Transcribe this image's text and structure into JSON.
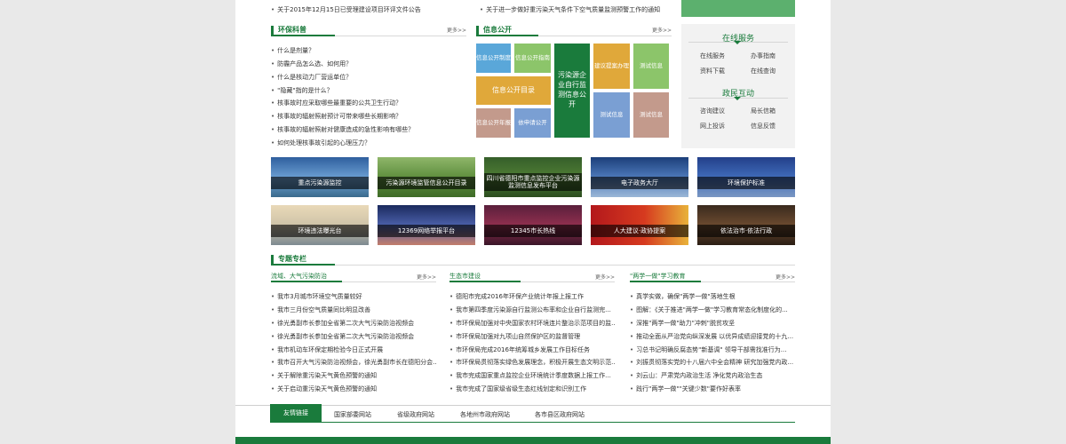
{
  "top_links": [
    "关于2015年12月15日已受理建设项目环评文件公告",
    "关于进一步做好重污染天气条件下空气质量监测预警工作的通知"
  ],
  "env_science": {
    "title": "环保科普",
    "more": "更多>>",
    "items": [
      "什么是剂量？",
      "防霾产品怎么选、如何用？",
      "什么是核动力厂营运单位？",
      "\"隐藏\"指的是什么？",
      "核事故时应采取哪些最重要的公共卫生行动？",
      "核事故的辐射照射预计可带来哪些长期影响？",
      "核事故的辐射照射对健康造成的急性影响有哪些？",
      "如何处理核事故引起的心理压力？"
    ]
  },
  "info_public": {
    "title": "信息公开",
    "more": "更多>>",
    "tiles": {
      "system": "信息公开制度",
      "guide": "信息公开指南",
      "catalog": "信息公开目录",
      "annual": "信息公开年报",
      "apply": "依申请公开",
      "enterprise": "污染源企业自行监测信息公开",
      "proposal": "建议提案办理",
      "test1": "测试信息",
      "test2": "测试信息",
      "test3": "测试信息"
    }
  },
  "online_service": {
    "title": "在线服务",
    "links": [
      "在线服务",
      "办事指南",
      "资料下载",
      "在线查询"
    ]
  },
  "interaction": {
    "title": "政民互动",
    "links": [
      "咨询建议",
      "局长信箱",
      "网上投诉",
      "信息反馈"
    ]
  },
  "image_links": [
    "重点污染源监控",
    "污染源环境监管信息公开目录",
    "四川省德阳市重点监控企业污染源监测信息发布平台",
    "电子政务大厅",
    "环境保护标准",
    "环境违法曝光台",
    "12369网络举报平台",
    "12345市长热线",
    "人大建议·政协提案",
    "依法治市·依法行政"
  ],
  "special": {
    "title": "专题专栏",
    "columns": [
      {
        "title": "流域、大气污染防治",
        "more": "更多>>",
        "items": [
          "我市3月城市环境空气质量较好",
          "我市三月份空气质量同比明显改善",
          "徐光勇副市长参加全省第二次大气污染防治视频会",
          "徐光勇副市长参加全省第二次大气污染防治视频会",
          "我市机动车环保定期检验今日正式开展",
          "我市召开大气污染防治视频会，徐光勇副市长在德阳分会...",
          "关于解除重污染天气黄色预警的通知",
          "关于启动重污染天气黄色预警的通知"
        ]
      },
      {
        "title": "生态市建设",
        "more": "更多>>",
        "items": [
          "德阳市完成2016年环保产业统计年报上报工作",
          "我市第四季度污染源自行监测公布率和企业自行监测完...",
          "市环保局加强对中央国家农村环境连片整治示范项目的监...",
          "市环保局加强对九项山自然保护区的监督管理",
          "市环保局完成2016年统筹城乡发展工作目标任务",
          "市环保局贯彻落实绿色发展理念，积极开展生态文明示范...",
          "我市完成国家重点监控企业环境统计季度数据上报工作...",
          "我市完成了国家级省级生态红线划定和识别工作"
        ]
      },
      {
        "title": "\"两学一做\"学习教育",
        "more": "更多>>",
        "items": [
          "真学实做，确保\"两学一做\"落地生根",
          "图解：《关于推进\"两学一做\"学习教育常态化制度化的...",
          "深推\"两学一做\"助力\"冲刺\"脱贫攻坚",
          "推动全面从严治党向纵深发展 以优异成绩迎接党的十九...",
          "习总书记明确反腐态势\"新基调\" 领导干部需找准行为...",
          "刘振贯彻落实党的十八届六中全会精神 研究加强党内政...",
          "刘云山：严肃党内政治生活 净化党内政治生态",
          "践行\"两学一做\"\"关键少数\"要作好表率"
        ]
      }
    ]
  },
  "footer": {
    "tab": "友情链接",
    "links": [
      "国家部委网站",
      "省级政府网站",
      "各地州市政府网站",
      "各市县区政府网站"
    ]
  },
  "colors": {
    "brand_green": "#1a7b3c",
    "light_green": "#5cb06e"
  }
}
